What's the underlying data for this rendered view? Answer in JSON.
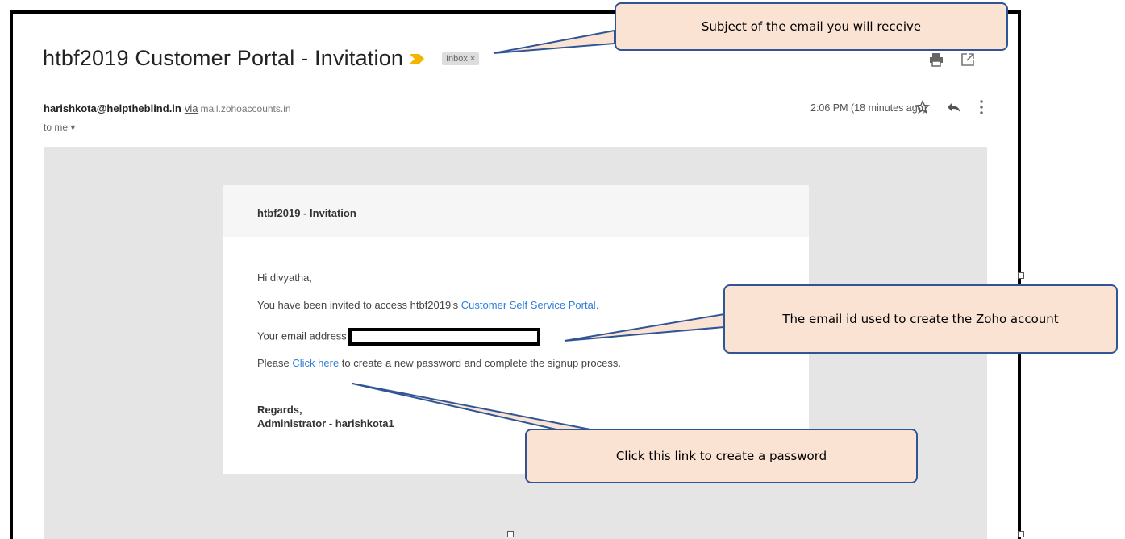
{
  "email": {
    "subject": "htbf2019 Customer Portal - Invitation",
    "inbox_label": "Inbox",
    "inbox_close": "×",
    "sender_email": "harishkota@helptheblind.in",
    "via_label": "via",
    "via_domain": "mail.zohoaccounts.in",
    "recipient": "to me",
    "time": "2:06 PM (18 minutes ago)"
  },
  "card": {
    "title": "htbf2019 - Invitation",
    "greeting": "Hi divyatha,",
    "invite_text": "You have been invited to access htbf2019's ",
    "portal_link": "Customer Self Service Portal.",
    "email_label": "Your email address",
    "please": "Please ",
    "click_here": "Click here",
    "signup_text": " to create a new password and complete the signup process.",
    "regards": "Regards,",
    "signature": "Administrator - harishkota1"
  },
  "callouts": {
    "subject_note": "Subject of the email you will receive",
    "email_note": "The email id used to create the Zoho account",
    "link_note": "Click this link to create a password"
  },
  "colors": {
    "callout_fill": "#fbe3d4",
    "callout_border": "#2f5597",
    "link": "#2f7ddb",
    "importance": "#f4b400"
  },
  "icons": [
    "importance-marker-icon",
    "print-icon",
    "popout-icon",
    "star-icon",
    "reply-icon",
    "more-vert-icon",
    "chevron-down-icon"
  ]
}
